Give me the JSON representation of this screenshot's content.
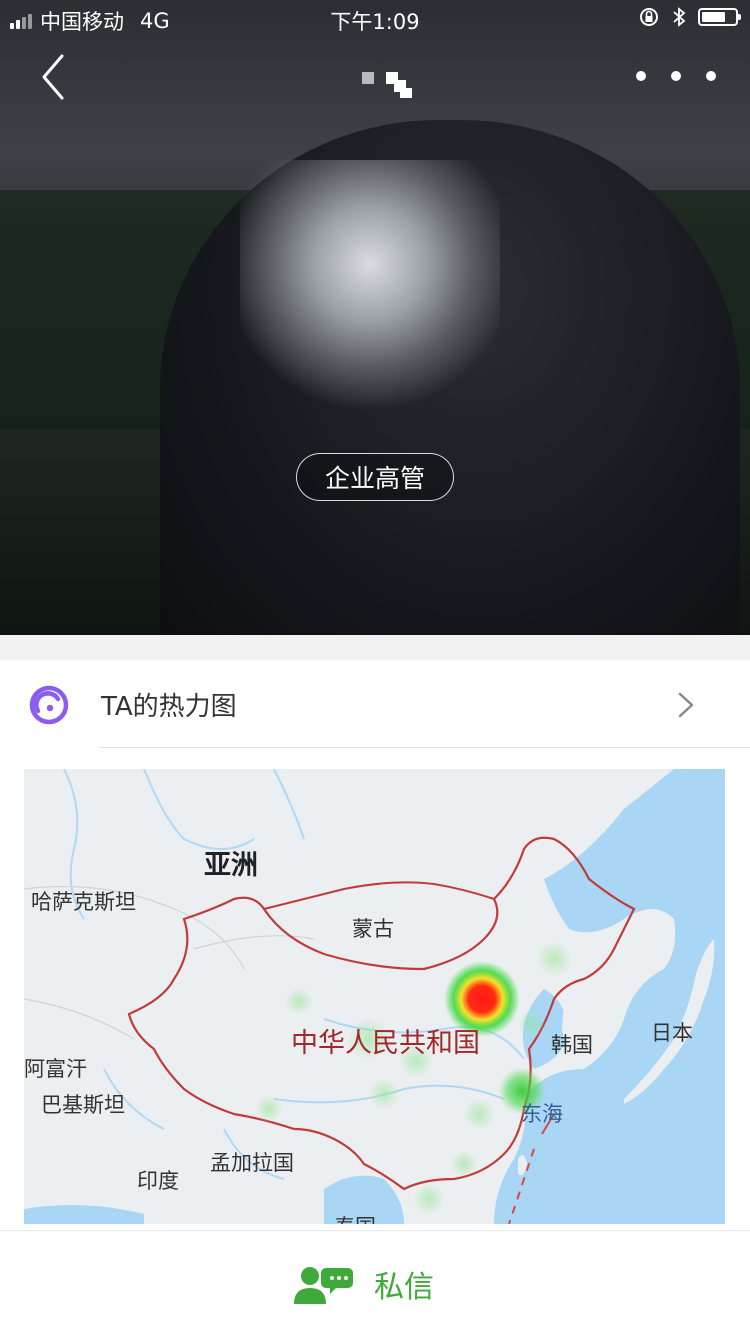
{
  "status_bar": {
    "carrier": "中国移动",
    "network": "4G",
    "time": "下午1:09"
  },
  "profile": {
    "role_tag": "企业高管"
  },
  "heatmap_card": {
    "title": "TA的热力图",
    "map_labels": {
      "asia": "亚洲",
      "kazakhstan": "哈萨克斯坦",
      "mongolia": "蒙古",
      "china": "中华人民共和国",
      "korea": "韩国",
      "japan": "日本",
      "afghanistan": "阿富汗",
      "pakistan": "巴基斯坦",
      "india": "印度",
      "bangladesh": "孟加拉国",
      "east_sea": "东海",
      "thailand": "泰国"
    }
  },
  "footer": {
    "message_label": "私信"
  },
  "icons": [
    "back-icon",
    "more-icon",
    "heatmap-icon",
    "chevron-right-icon",
    "message-user-icon",
    "bluetooth-icon",
    "rotation-lock-icon",
    "battery-icon",
    "signal-icon"
  ],
  "colors": {
    "accent_green": "#3faa3a",
    "heatmap_icon_purple": "#8a5cf0",
    "border_red": "#c23b3b",
    "water_blue": "#a9d6f5"
  }
}
